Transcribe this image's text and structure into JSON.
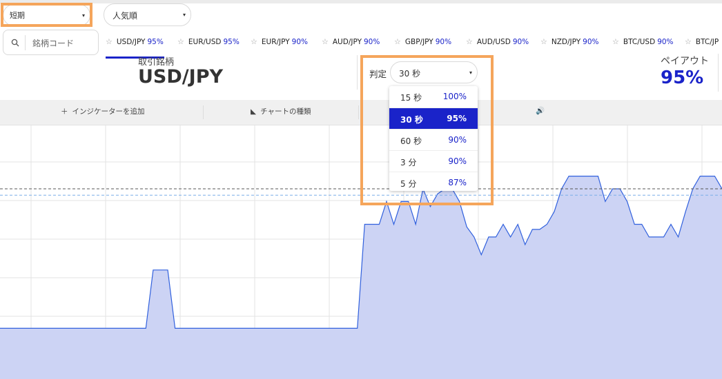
{
  "filters": {
    "term": "短期",
    "sort": "人気順"
  },
  "search": {
    "placeholder": "銘柄コード"
  },
  "symbols": [
    {
      "pair": "USD/JPY",
      "payout": "95%"
    },
    {
      "pair": "EUR/USD",
      "payout": "95%"
    },
    {
      "pair": "EUR/JPY",
      "payout": "90%"
    },
    {
      "pair": "AUD/JPY",
      "payout": "90%"
    },
    {
      "pair": "GBP/JPY",
      "payout": "90%"
    },
    {
      "pair": "AUD/USD",
      "payout": "90%"
    },
    {
      "pair": "NZD/JPY",
      "payout": "90%"
    },
    {
      "pair": "BTC/USD",
      "payout": "90%"
    },
    {
      "pair": "BTC/JP",
      "payout": ""
    }
  ],
  "trade": {
    "label": "取引銘柄",
    "pair": "USD/JPY"
  },
  "judgement": {
    "label": "判定",
    "selected": "30 秒",
    "options": [
      {
        "time": "15 秒",
        "payout": "100%"
      },
      {
        "time": "30 秒",
        "payout": "95%"
      },
      {
        "time": "60 秒",
        "payout": "90%"
      },
      {
        "time": "3 分",
        "payout": "90%"
      },
      {
        "time": "5 分",
        "payout": "87%"
      }
    ]
  },
  "payout": {
    "label": "ペイアウト",
    "value": "95%"
  },
  "toolbar": {
    "add_indicator": "インジケーターを追加",
    "chart_type": "チャートの種類"
  },
  "icons": {
    "search": "search-icon",
    "star": "star-icon",
    "plus": "plus-icon",
    "chart_type": "area-chart-icon",
    "sound": "speaker-icon"
  },
  "colors": {
    "accent": "#1a23c9",
    "highlight": "#f5a55b",
    "area_fill": "#ccd3f4",
    "area_line": "#3060dd"
  },
  "chart_data": {
    "type": "area",
    "series_y": [
      2,
      2,
      2,
      2,
      2,
      2,
      2,
      2,
      2,
      2,
      2,
      2,
      2,
      2,
      2,
      2,
      2,
      2,
      2,
      2,
      2,
      4.3,
      4.3,
      4.3,
      2,
      2,
      2,
      2,
      2,
      2,
      2,
      2,
      2,
      2,
      2,
      2,
      2,
      2,
      2,
      2,
      2,
      2,
      2,
      2,
      2,
      2,
      2,
      2,
      2,
      2,
      6.1,
      6.1,
      6.1,
      7.0,
      6.1,
      7.0,
      7.0,
      6.1,
      7.5,
      6.8,
      7.3,
      7.5,
      7.5,
      7.0,
      6.0,
      5.6,
      4.9,
      5.6,
      5.6,
      6.1,
      5.6,
      6.1,
      5.3,
      5.9,
      5.9,
      6.1,
      6.6,
      7.5,
      8.0,
      8.0,
      8.0,
      8.0,
      8.0,
      7.0,
      7.5,
      7.5,
      7.0,
      6.1,
      6.1,
      5.6,
      5.6,
      5.6,
      6.1,
      5.6,
      6.6,
      7.5,
      8.0,
      8.0,
      8.0,
      7.5
    ],
    "reference_lines": [
      7.5,
      7.25
    ]
  }
}
